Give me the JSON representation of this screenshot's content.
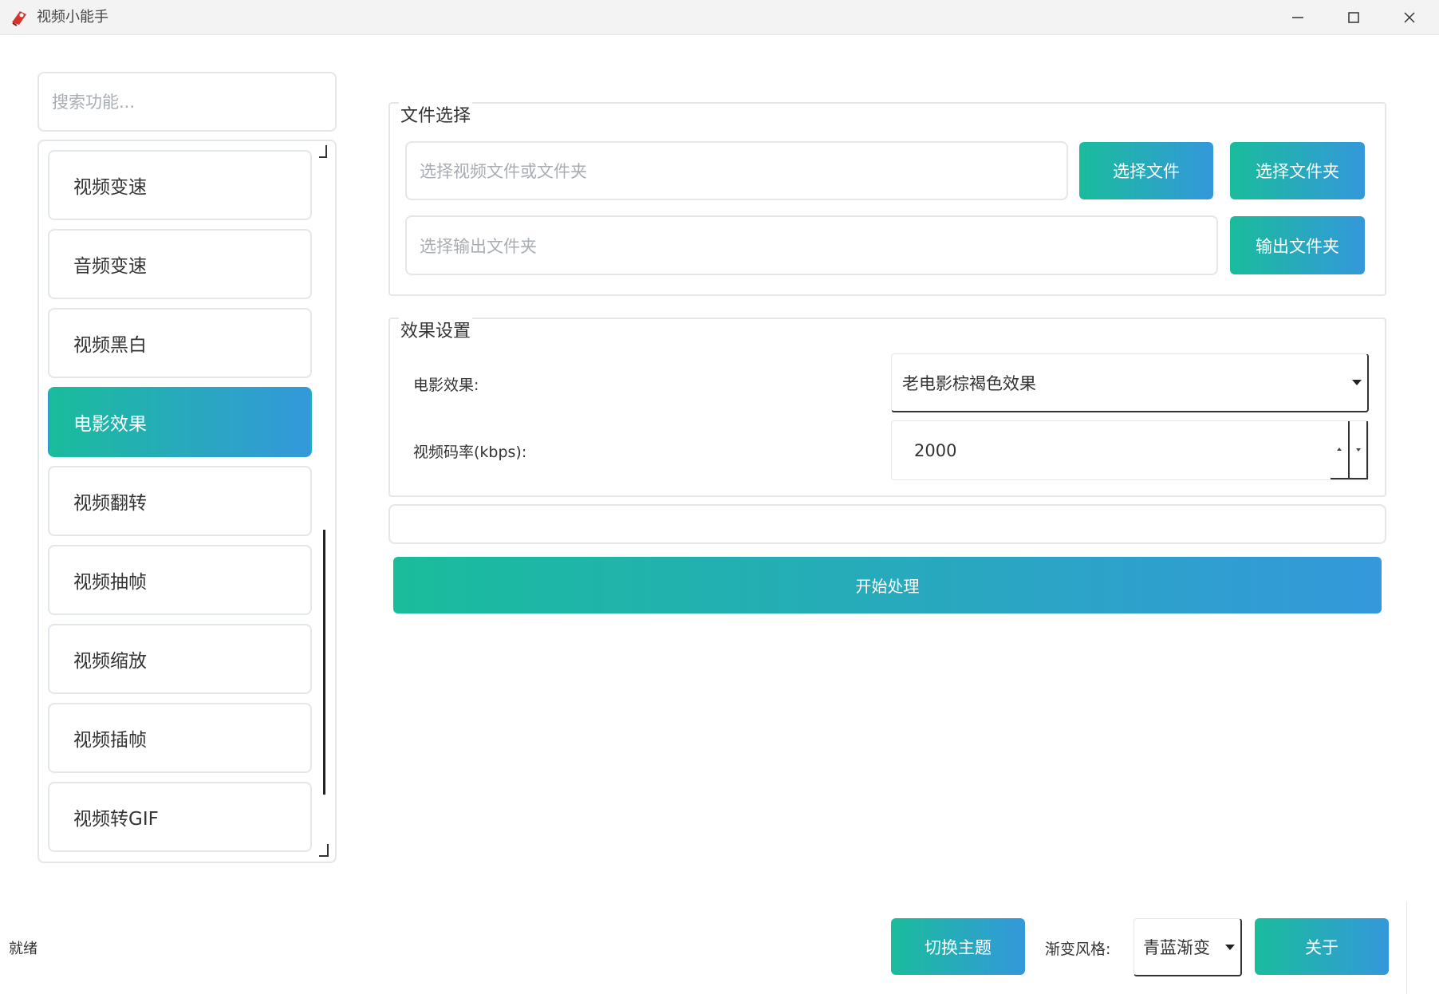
{
  "window": {
    "title": "视频小能手"
  },
  "search": {
    "placeholder": "搜索功能..."
  },
  "sidebar": {
    "items": [
      {
        "label": "视频变速"
      },
      {
        "label": "音频变速"
      },
      {
        "label": "视频黑白"
      },
      {
        "label": "电影效果",
        "active": true
      },
      {
        "label": "视频翻转"
      },
      {
        "label": "视频抽帧"
      },
      {
        "label": "视频缩放"
      },
      {
        "label": "视频插帧"
      },
      {
        "label": "视频转GIF"
      }
    ]
  },
  "file_group": {
    "title": "文件选择",
    "input_placeholder": "选择视频文件或文件夹",
    "output_placeholder": "选择输出文件夹",
    "select_file_label": "选择文件",
    "select_folder_label": "选择文件夹",
    "output_folder_label": "输出文件夹"
  },
  "effect_group": {
    "title": "效果设置",
    "effect_label": "电影效果:",
    "effect_value": "老电影棕褐色效果",
    "bitrate_label": "视频码率(kbps):",
    "bitrate_value": "2000"
  },
  "actions": {
    "start_label": "开始处理"
  },
  "footer": {
    "status": "就绪",
    "switch_theme_label": "切换主题",
    "gradient_style_label": "渐变风格:",
    "gradient_style_value": "青蓝渐变",
    "about_label": "关于"
  },
  "colors": {
    "accent_start": "#1abc9c",
    "accent_end": "#3498db"
  }
}
